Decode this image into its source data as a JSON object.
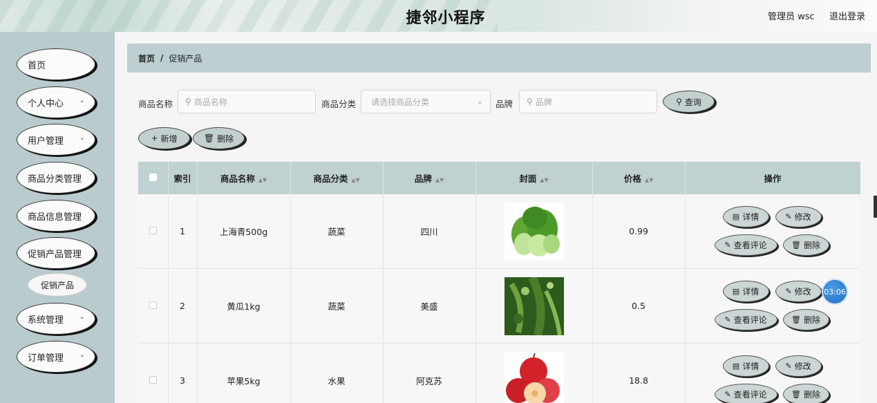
{
  "header": {
    "title": "捷邻小程序",
    "admin": "管理员 wsc",
    "logout": "退出登录"
  },
  "sidebar": {
    "items": [
      {
        "label": "首页",
        "has_children": false
      },
      {
        "label": "个人中心",
        "has_children": true
      },
      {
        "label": "用户管理",
        "has_children": true
      },
      {
        "label": "商品分类管理",
        "has_children": false
      },
      {
        "label": "商品信息管理",
        "has_children": false
      },
      {
        "label": "促销产品管理",
        "has_children": false
      },
      {
        "label": "系统管理",
        "has_children": true
      },
      {
        "label": "订单管理",
        "has_children": true
      }
    ],
    "sub_item": "促销产品"
  },
  "breadcrumb": {
    "home": "首页",
    "separator": "/",
    "current": "促销产品"
  },
  "search": {
    "name_label": "商品名称",
    "name_placeholder": "商品名称",
    "category_label": "商品分类",
    "category_placeholder": "请选择商品分类",
    "brand_label": "品牌",
    "brand_placeholder": "品牌",
    "query_button": "查询"
  },
  "actions": {
    "add": "新增",
    "delete": "删除"
  },
  "table": {
    "headers": [
      "索引",
      "商品名称",
      "商品分类",
      "品牌",
      "封面",
      "价格",
      "操作"
    ],
    "rows": [
      {
        "index": "1",
        "name": "上海青500g",
        "category": "蔬菜",
        "brand": "四川",
        "cover_icon": "bok-choy-image",
        "price": "0.99"
      },
      {
        "index": "2",
        "name": "黄瓜1kg",
        "category": "蔬菜",
        "brand": "美盛",
        "cover_icon": "cucumber-image",
        "price": "0.5"
      },
      {
        "index": "3",
        "name": "苹果5kg",
        "category": "水果",
        "brand": "阿克苏",
        "cover_icon": "apple-image",
        "price": "18.8"
      }
    ],
    "row_actions": {
      "detail": "详情",
      "edit": "修改",
      "comments": "查看评论",
      "delete": "删除"
    }
  },
  "timer": "03:06",
  "colors": {
    "sidebar_bg": "#b9cbcc",
    "header_row_bg": "#c0d1d2",
    "timer_blue": "#1f6fc5"
  }
}
